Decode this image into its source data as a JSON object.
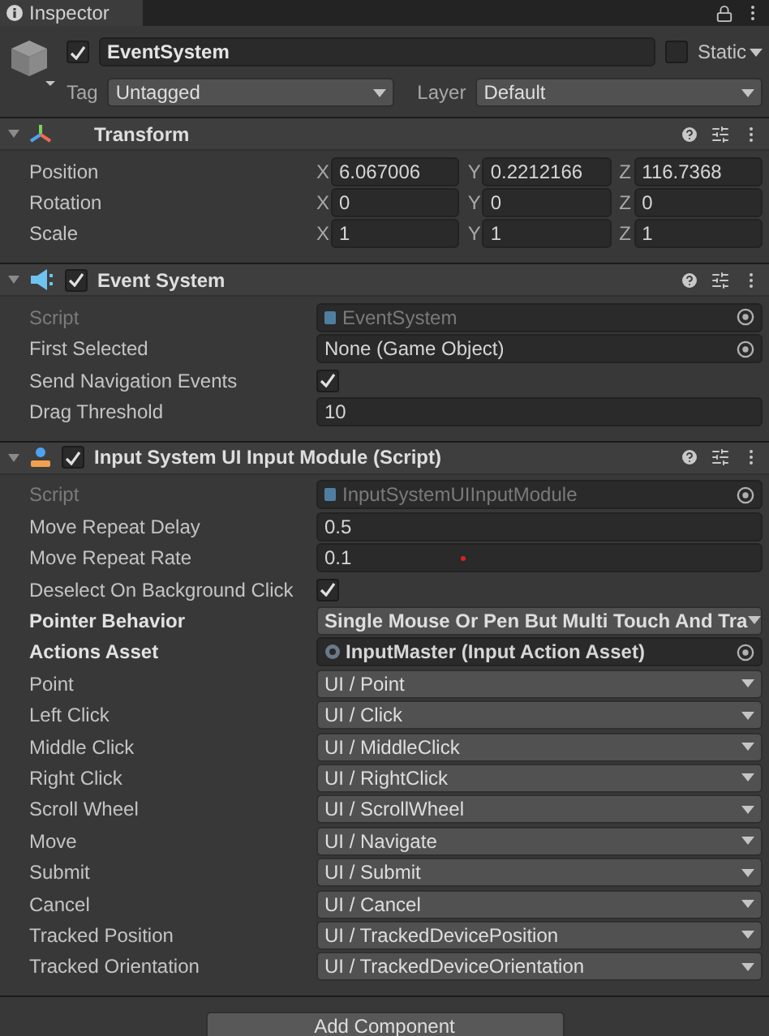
{
  "tab": {
    "label": "Inspector"
  },
  "object": {
    "active": true,
    "name": "EventSystem",
    "static": false,
    "static_label": "Static",
    "tag_label": "Tag",
    "tag": "Untagged",
    "layer_label": "Layer",
    "layer": "Default"
  },
  "components": [
    {
      "kind": "transform",
      "title": "Transform",
      "expanded": true,
      "rows": [
        {
          "kind": "vector",
          "label": "Position",
          "modified": false,
          "values": [
            {
              "axis": "X",
              "value": "6.067006"
            },
            {
              "axis": "Y",
              "value": "0.2212166"
            },
            {
              "axis": "Z",
              "value": "116.7368"
            }
          ]
        },
        {
          "kind": "vector",
          "label": "Rotation",
          "modified": false,
          "values": [
            {
              "axis": "X",
              "value": "0"
            },
            {
              "axis": "Y",
              "value": "0"
            },
            {
              "axis": "Z",
              "value": "0"
            }
          ]
        },
        {
          "kind": "vector",
          "label": "Scale",
          "modified": false,
          "values": [
            {
              "axis": "X",
              "value": "1"
            },
            {
              "axis": "Y",
              "value": "1"
            },
            {
              "axis": "Z",
              "value": "1"
            }
          ]
        }
      ]
    },
    {
      "kind": "event_system",
      "title": "Event System",
      "enabled": true,
      "expanded": true,
      "rows": [
        {
          "kind": "script",
          "label": "Script",
          "modified": false,
          "value": "EventSystem"
        },
        {
          "kind": "object",
          "label": "First Selected",
          "modified": false,
          "value": "None (Game Object)"
        },
        {
          "kind": "checkbox",
          "label": "Send Navigation Events",
          "modified": false,
          "checked": true
        },
        {
          "kind": "number",
          "label": "Drag Threshold",
          "modified": false,
          "value": "10"
        }
      ]
    },
    {
      "kind": "input_module",
      "title": "Input System UI Input Module (Script)",
      "enabled": true,
      "expanded": true,
      "rows": [
        {
          "kind": "script",
          "label": "Script",
          "modified": false,
          "value": "InputSystemUIInputModule"
        },
        {
          "kind": "number",
          "label": "Move Repeat Delay",
          "modified": false,
          "value": "0.5"
        },
        {
          "kind": "number",
          "label": "Move Repeat Rate",
          "modified": false,
          "value": "0.1"
        },
        {
          "kind": "checkbox",
          "label": "Deselect On Background Click",
          "modified": false,
          "checked": true
        },
        {
          "kind": "dropdown",
          "label": "Pointer Behavior",
          "modified": true,
          "value": "Single Mouse Or Pen But Multi Touch And Tra"
        },
        {
          "kind": "object",
          "label": "Actions Asset",
          "modified": true,
          "value": "InputMaster (Input Action Asset)",
          "asset": true
        },
        {
          "kind": "dropdown",
          "label": "Point",
          "modified": false,
          "value": "UI / Point"
        },
        {
          "kind": "dropdown",
          "label": "Left Click",
          "modified": false,
          "value": "UI / Click"
        },
        {
          "kind": "dropdown",
          "label": "Middle Click",
          "modified": false,
          "value": "UI / MiddleClick"
        },
        {
          "kind": "dropdown",
          "label": "Right Click",
          "modified": false,
          "value": "UI / RightClick"
        },
        {
          "kind": "dropdown",
          "label": "Scroll Wheel",
          "modified": false,
          "value": "UI / ScrollWheel"
        },
        {
          "kind": "dropdown",
          "label": "Move",
          "modified": false,
          "value": "UI / Navigate"
        },
        {
          "kind": "dropdown",
          "label": "Submit",
          "modified": false,
          "value": "UI / Submit"
        },
        {
          "kind": "dropdown",
          "label": "Cancel",
          "modified": false,
          "value": "UI / Cancel"
        },
        {
          "kind": "dropdown",
          "label": "Tracked Position",
          "modified": false,
          "value": "UI / TrackedDevicePosition"
        },
        {
          "kind": "dropdown",
          "label": "Tracked Orientation",
          "modified": false,
          "value": "UI / TrackedDeviceOrientation"
        }
      ]
    }
  ],
  "add_component": "Add Component"
}
